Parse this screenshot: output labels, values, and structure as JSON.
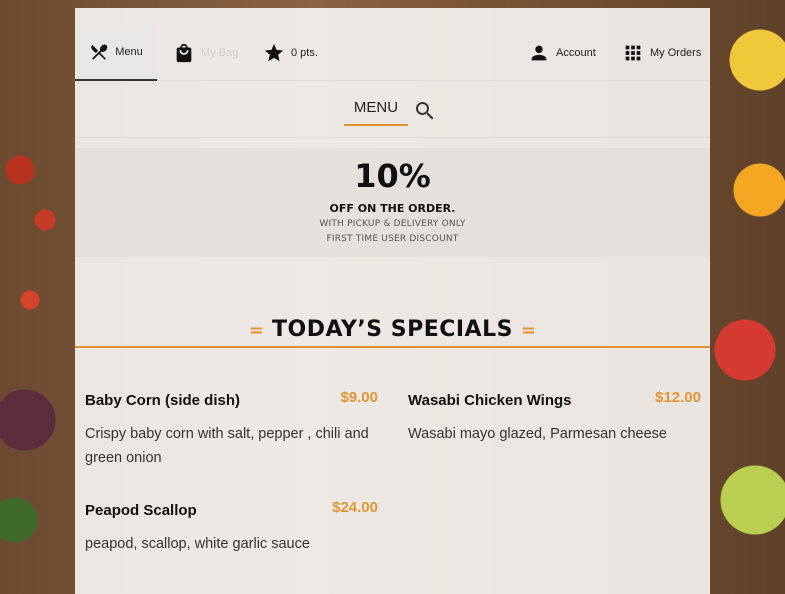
{
  "nav": {
    "items": [
      {
        "label": "Menu",
        "icon": "fork-knife-icon",
        "active": true
      },
      {
        "label": "My Bag",
        "icon": "shopping-bag-icon"
      },
      {
        "label": "0 pts.",
        "icon": "star-icon"
      },
      {
        "label": "Account",
        "icon": "person-icon"
      },
      {
        "label": "My Orders",
        "icon": "grid-icon"
      }
    ]
  },
  "subnav": {
    "menu_label": "MENU",
    "search_icon": "search-icon"
  },
  "promo": {
    "percent": "10%",
    "headline": "OFF ON THE ORDER.",
    "line1": "WITH PICKUP & DELIVERY ONLY",
    "line2": "FIRST TIME USER DISCOUNT"
  },
  "specials": {
    "title": "TODAY’S SPECIALS",
    "deco": "=",
    "items": [
      {
        "name": "Baby Corn (side dish)",
        "price": "$9.00",
        "description": "Crispy baby corn with salt, pepper , chili and green onion"
      },
      {
        "name": "Wasabi Chicken Wings",
        "price": "$12.00",
        "description": "Wasabi mayo glazed, Parmesan cheese"
      },
      {
        "name": "Peapod Scallop",
        "price": "$24.00",
        "description": "peapod, scallop, white garlic sauce"
      }
    ]
  },
  "colors": {
    "accent": "#e39532"
  }
}
